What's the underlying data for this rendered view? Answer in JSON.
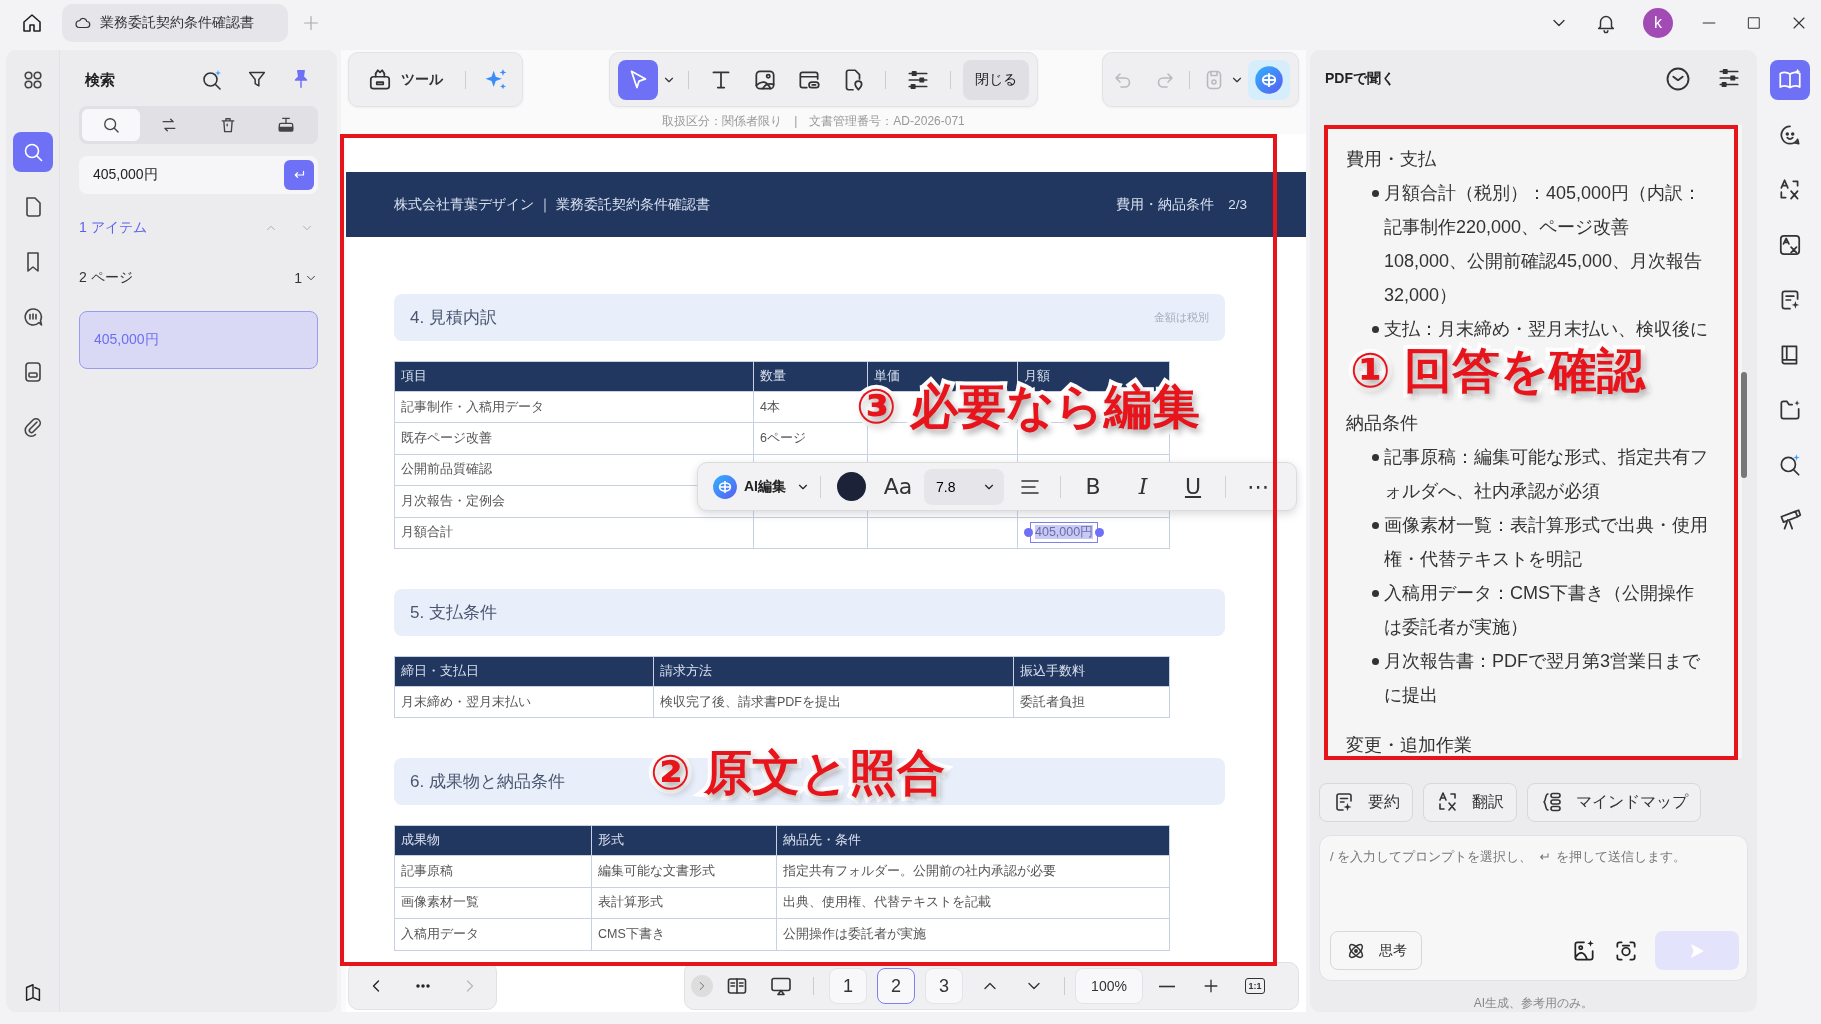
{
  "title_bar": {
    "tab_title": "業務委託契約条件確認書",
    "avatar": "k"
  },
  "nav_rail": {
    "items": [
      {
        "selected": false
      },
      {
        "selected": true
      },
      {
        "selected": false
      },
      {
        "selected": false
      },
      {
        "selected": false
      },
      {
        "selected": false
      },
      {
        "selected": false
      }
    ]
  },
  "search_panel": {
    "title": "検索",
    "modes": [
      {
        "selected": true
      },
      {
        "selected": false
      },
      {
        "selected": false
      },
      {
        "selected": false
      }
    ],
    "query": "405,000円",
    "result_count": "1 アイテム",
    "page_group": {
      "label": "2 ページ",
      "count": "1"
    },
    "results": [
      {
        "text": "405,000円",
        "selected": true
      }
    ]
  },
  "toolbar": {
    "tools_label": "ツール",
    "edit_tools": [
      {
        "selected": true
      },
      {
        "selected": false
      },
      {
        "selected": false
      },
      {
        "selected": false
      },
      {
        "selected": false
      },
      {
        "selected": false
      }
    ],
    "close_label": "閉じる"
  },
  "document": {
    "meta": "取扱区分：関係者限り　|　文書管理番号：AD-2026-071",
    "header_left": "株式会社青葉デザイン ｜ 業務委託契約条件確認書",
    "header_right": "費用・納品条件　2/3",
    "sections": [
      {
        "title": "4. 見積内訳",
        "note": "金額は税別",
        "columns": [
          "項目",
          "数量",
          "単価",
          "月額"
        ],
        "rows": [
          [
            "記事制作・入稿用データ",
            "4本",
            null,
            null
          ],
          [
            "既存ページ改善",
            "6ページ",
            null,
            null
          ],
          [
            "公開前品質確認",
            null,
            null,
            null
          ],
          [
            "月次報告・定例会",
            null,
            null,
            null
          ],
          [
            "月額合計",
            null,
            null,
            {
              "text": "405,000円",
              "selected": true
            }
          ]
        ]
      },
      {
        "title": "5. 支払条件",
        "columns": [
          "締日・支払日",
          "請求方法",
          "振込手数料"
        ],
        "rows": [
          [
            "月末締め・翌月末払い",
            "検収完了後、請求書PDFを提出",
            "委託者負担"
          ]
        ]
      },
      {
        "title": "6. 成果物と納品条件",
        "columns": [
          "成果物",
          "形式",
          "納品先・条件"
        ],
        "rows": [
          [
            "記事原稿",
            "編集可能な文書形式",
            "指定共有フォルダー。公開前の社内承認が必要"
          ],
          [
            "画像素材一覧",
            "表計算形式",
            "出典、使用権、代替テキストを記載"
          ],
          [
            "入稿用データ",
            "CMS下書き",
            "公開操作は委託者が実施"
          ]
        ]
      }
    ]
  },
  "edit_popup": {
    "ai_label": "AI編集",
    "font_button": "Aa",
    "font_size": "7.8",
    "format_buttons": [
      "B",
      "I",
      "U"
    ],
    "more": "⋯"
  },
  "page_nav": {
    "pages": [
      {
        "label": "1",
        "selected": false
      },
      {
        "label": "2",
        "selected": true
      },
      {
        "label": "3",
        "selected": false
      }
    ],
    "zoom": "100%",
    "actual_size": "1:1"
  },
  "ai_panel": {
    "title": "PDFで聞く",
    "answer": [
      {
        "heading": "費用・支払",
        "bullets": [
          "月額合計（税別）：405,000円（内訳：記事制作220,000、ページ改善108,000、公開前確認45,000、月次報告32,000）",
          "支払：月末締め・翌月末払い、検収後に"
        ]
      },
      {
        "heading": "納品条件",
        "bullets": [
          "記事原稿：編集可能な形式、指定共有フォルダへ、社内承認が必須",
          "画像素材一覧：表計算形式で出典・使用権・代替テキストを明記",
          "入稿用データ：CMS下書き（公開操作は委託者が実施）",
          "月次報告書：PDFで翌月第3営業日までに提出"
        ]
      },
      {
        "heading": "変更・追加作業"
      }
    ],
    "actions": [
      "要約",
      "翻訳",
      "マインドマップ"
    ],
    "prompt": {
      "placeholder": [
        "/ を入力してプロンプトを選択し、",
        "を押して送信します。"
      ]
    },
    "think_label": "思考",
    "footer": "AI生成、参考用のみ。"
  },
  "right_rail": {
    "items": [
      {
        "selected": true
      },
      {
        "selected": false
      },
      {
        "selected": false
      },
      {
        "selected": false
      },
      {
        "selected": false
      },
      {
        "selected": false
      },
      {
        "selected": false
      },
      {
        "selected": false
      },
      {
        "selected": false
      }
    ]
  },
  "annotations": [
    {
      "text": "① 回答を確認"
    },
    {
      "text": "③ 必要なら編集"
    },
    {
      "text": "② 原文と照合"
    }
  ]
}
